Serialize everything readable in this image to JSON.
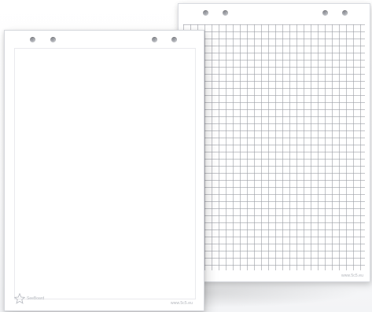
{
  "scene": {
    "back_sheet": {
      "pattern": "grid",
      "grid_color": "#9a9ca4",
      "footer_text": "www.5c5.eu"
    },
    "front_sheet": {
      "pattern": "plain",
      "footer_text": "www.5c5.eu",
      "logo_text": "SeeBoard"
    }
  }
}
